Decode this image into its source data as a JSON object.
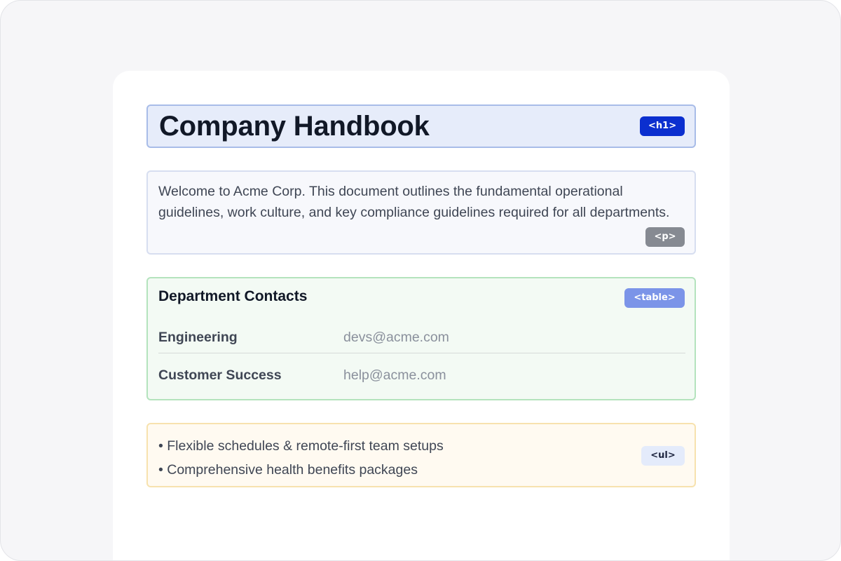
{
  "heading": {
    "title": "Company Handbook",
    "tag": "<h1>"
  },
  "intro": {
    "text": "Welcome to Acme Corp. This document outlines the fundamental operational guidelines, work culture, and key compliance guidelines required for all departments.",
    "tag": "<p>"
  },
  "contacts": {
    "title": "Department Contacts",
    "tag": "<table>",
    "rows": [
      {
        "department": "Engineering",
        "email": "devs@acme.com"
      },
      {
        "department": "Customer Success",
        "email": "help@acme.com"
      }
    ]
  },
  "benefits": {
    "tag": "<ul>",
    "items": [
      "• Flexible schedules & remote-first team setups",
      "• Comprehensive health benefits packages"
    ]
  },
  "colors": {
    "h1_badge": "#0b2fcf",
    "p_badge": "#868a92",
    "table_badge": "#7b94e8",
    "ul_badge": "#e4ebfb"
  }
}
